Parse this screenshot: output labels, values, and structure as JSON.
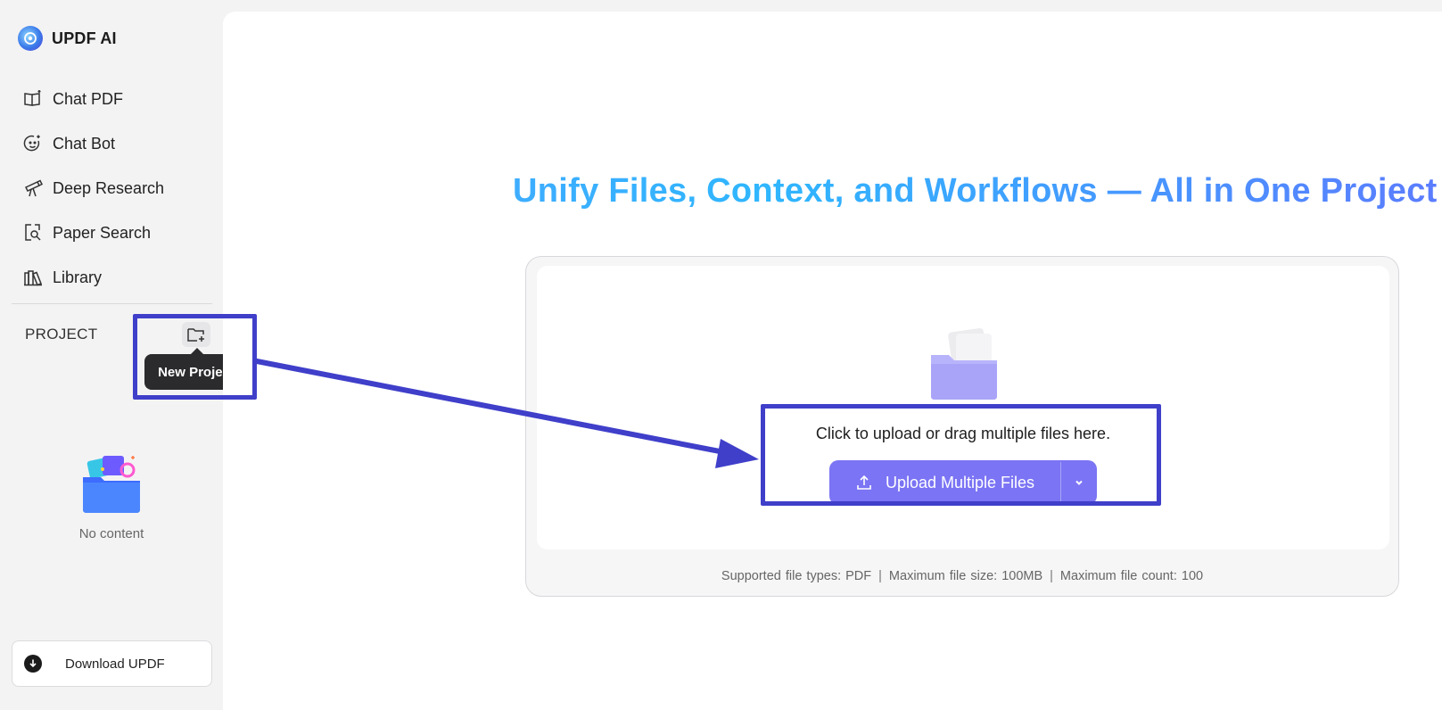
{
  "app": {
    "title": "UPDF AI"
  },
  "sidebar": {
    "items": [
      {
        "label": "Chat PDF",
        "icon": "book-sparkle-icon"
      },
      {
        "label": "Chat Bot",
        "icon": "bot-face-icon"
      },
      {
        "label": "Deep Research",
        "icon": "telescope-icon"
      },
      {
        "label": "Paper Search",
        "icon": "document-search-icon"
      },
      {
        "label": "Library",
        "icon": "library-books-icon"
      }
    ],
    "project_label": "PROJECT",
    "new_project_tooltip": "New Project",
    "empty_text": "No content",
    "download_label": "Download UPDF"
  },
  "main": {
    "headline": "Unify Files, Context, and Workflows — All in One Project",
    "upload": {
      "instruction": "Click to upload or drag multiple files here.",
      "button_label": "Upload Multiple Files",
      "supported_types": "Supported file types: PDF",
      "max_size": "Maximum file size: 100MB",
      "max_count": "Maximum file count: 100"
    }
  },
  "colors": {
    "accent": "#7b74f4",
    "headline_gradient_start": "#4fa3ff",
    "headline_gradient_end": "#5b7cff",
    "annotation": "#3f3fca"
  }
}
